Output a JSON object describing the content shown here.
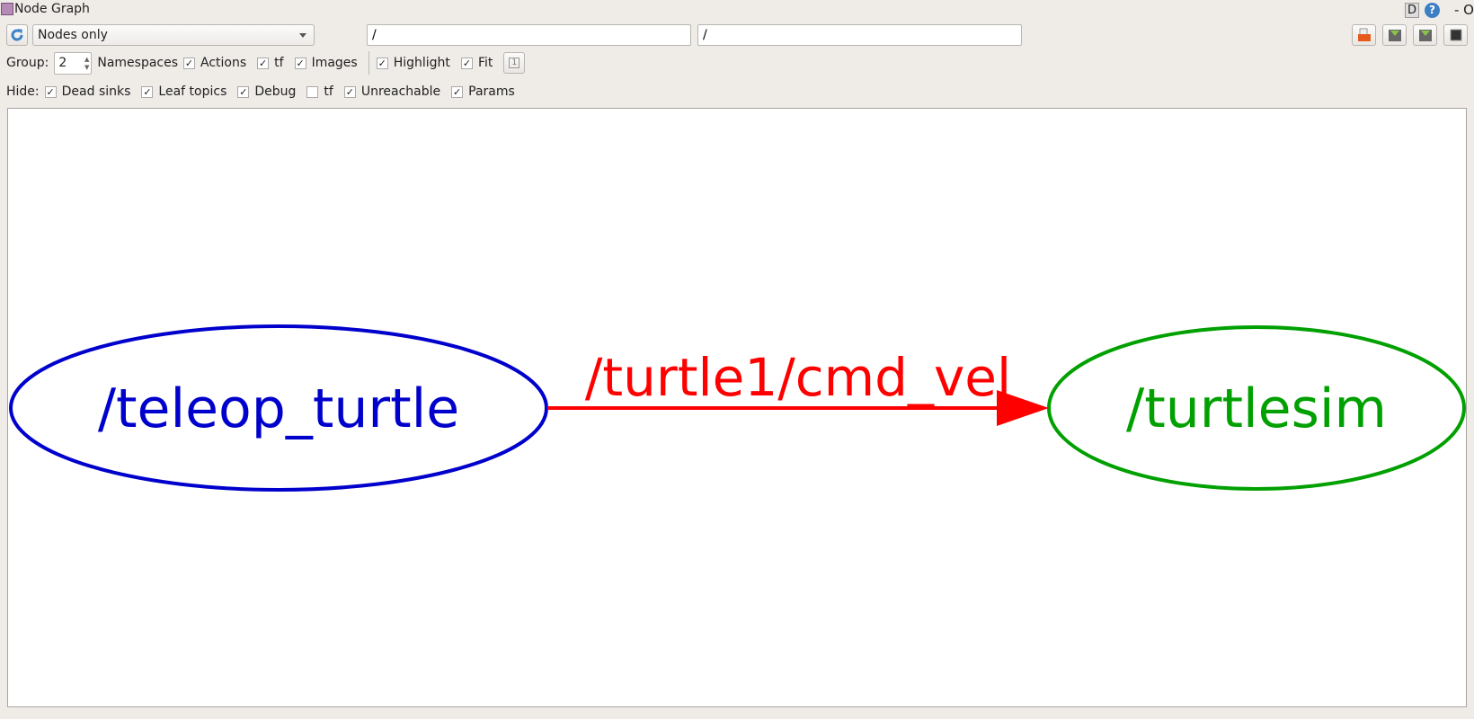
{
  "window": {
    "title": "Node Graph",
    "d_label": "D",
    "help_label": "?",
    "controls": "- O"
  },
  "toolbar": {
    "graph_type": "Nodes only",
    "node_filter": "/",
    "topic_filter": "/"
  },
  "options": {
    "group_label": "Group:",
    "group_value": "2",
    "items": [
      {
        "label": "Namespaces",
        "checked": true
      },
      {
        "label": "Actions",
        "checked": true
      },
      {
        "label": "tf",
        "checked": true
      },
      {
        "label": "Images",
        "checked": true
      },
      {
        "label": "Highlight",
        "checked": true
      },
      {
        "label": "Fit",
        "checked": true
      }
    ]
  },
  "hide": {
    "label": "Hide:",
    "items": [
      {
        "label": "Dead sinks",
        "checked": true
      },
      {
        "label": "Leaf topics",
        "checked": true
      },
      {
        "label": "Debug",
        "checked": true
      },
      {
        "label": "tf",
        "checked": false
      },
      {
        "label": "Unreachable",
        "checked": true
      },
      {
        "label": "Params",
        "checked": true
      }
    ]
  },
  "graph": {
    "nodes": [
      {
        "label": "/teleop_turtle",
        "color": "#0000cc"
      },
      {
        "label": "/turtlesim",
        "color": "#00a000"
      }
    ],
    "edges": [
      {
        "from": "/teleop_turtle",
        "to": "/turtlesim",
        "label": "/turtle1/cmd_vel",
        "color": "#ff0000"
      }
    ]
  }
}
